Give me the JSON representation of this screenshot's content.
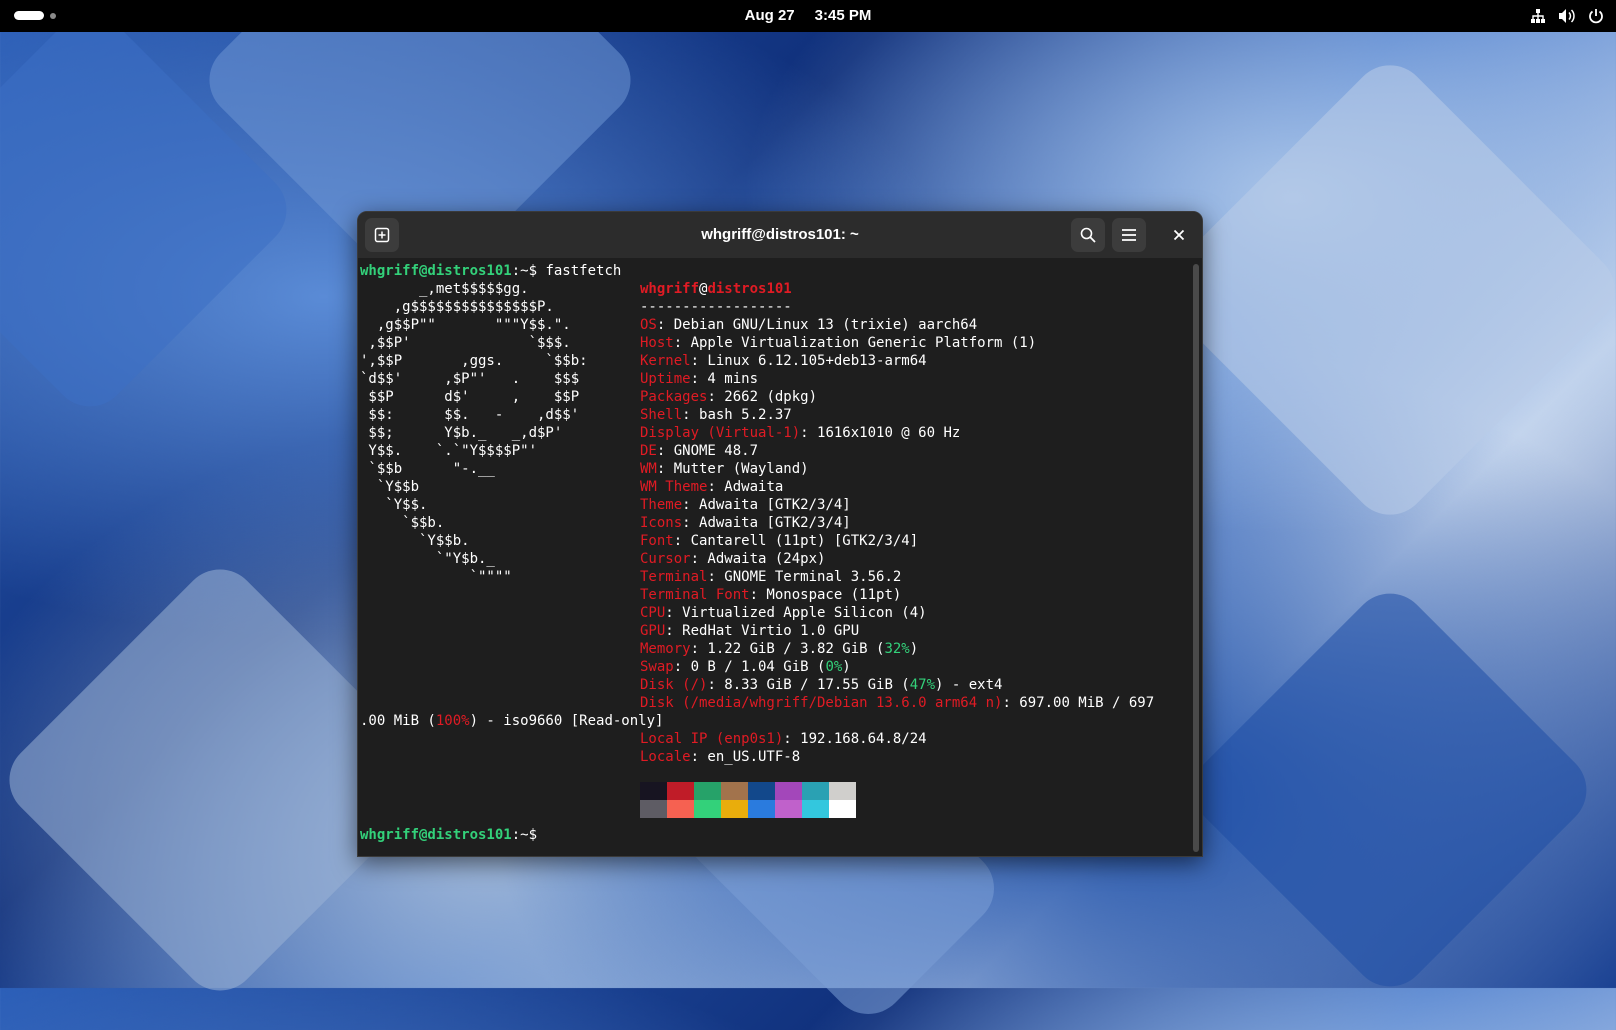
{
  "topbar": {
    "date": "Aug 27",
    "time": "3:45 PM"
  },
  "window": {
    "title": "whgriff@distros101: ~"
  },
  "terminal": {
    "prompt_user_host": "whgriff@distros101",
    "prompt_suffix": ":~$",
    "command": " fastfetch",
    "logo": [
      "       _,met$$$$$gg.",
      "    ,g$$$$$$$$$$$$$$$P.",
      "  ,g$$P\"\"       \"\"\"Y$$.\".",
      " ,$$P'              `$$$.",
      "',$$P       ,ggs.     `$$b:",
      "`d$$'     ,$P\"'   .    $$$",
      " $$P      d$'     ,    $$P",
      " $$:      $$.   -    ,d$$'",
      " $$;      Y$b._   _,d$P'",
      " Y$$.    `.`\"Y$$$$P\"'",
      " `$$b      \"-.__",
      "  `Y$$b",
      "   `Y$$.",
      "     `$$b.",
      "       `Y$$b.",
      "         `\"Y$b._",
      "             `\"\"\"\""
    ],
    "header_user": "whgriff",
    "header_at": "@",
    "header_host": "distros101",
    "separator": "------------------",
    "info": [
      {
        "key": "OS",
        "value": ": Debian GNU/Linux 13 (trixie) aarch64"
      },
      {
        "key": "Host",
        "value": ": Apple Virtualization Generic Platform (1)"
      },
      {
        "key": "Kernel",
        "value": ": Linux 6.12.105+deb13-arm64"
      },
      {
        "key": "Uptime",
        "value": ": 4 mins"
      },
      {
        "key": "Packages",
        "value": ": 2662 (dpkg)"
      },
      {
        "key": "Shell",
        "value": ": bash 5.2.37"
      },
      {
        "key": "Display (Virtual-1)",
        "value": ": 1616x1010 @ 60 Hz"
      },
      {
        "key": "DE",
        "value": ": GNOME 48.7"
      },
      {
        "key": "WM",
        "value": ": Mutter (Wayland)"
      },
      {
        "key": "WM Theme",
        "value": ": Adwaita"
      },
      {
        "key": "Theme",
        "value": ": Adwaita [GTK2/3/4]"
      },
      {
        "key": "Icons",
        "value": ": Adwaita [GTK2/3/4]"
      },
      {
        "key": "Font",
        "value": ": Cantarell (11pt) [GTK2/3/4]"
      },
      {
        "key": "Cursor",
        "value": ": Adwaita (24px)"
      },
      {
        "key": "Terminal",
        "value": ": GNOME Terminal 3.56.2"
      },
      {
        "key": "Terminal Font",
        "value": ": Monospace (11pt)"
      },
      {
        "key": "CPU",
        "value": ": Virtualized Apple Silicon (4)"
      },
      {
        "key": "GPU",
        "value": ": RedHat Virtio 1.0 GPU"
      }
    ],
    "memory": {
      "key": "Memory",
      "pre": ": 1.22 GiB / 3.82 GiB (",
      "pct": "32%",
      "post": ")"
    },
    "swap": {
      "key": "Swap",
      "pre": ": 0 B / 1.04 GiB (",
      "pct": "0%",
      "post": ")"
    },
    "disk_root": {
      "key": "Disk (/)",
      "pre": ": 8.33 GiB / 17.55 GiB (",
      "pct": "47%",
      "post": ") - ext4"
    },
    "disk_media": {
      "key": "Disk (/media/whgriff/Debian 13.6.0 arm64 n)",
      "pre": ": 697.00 MiB / 697"
    },
    "disk_media_wrap": {
      "pre": ".00 MiB (",
      "pct": "100%",
      "post": ") - iso9660 [Read-only]"
    },
    "local_ip": {
      "key": "Local IP (enp0s1)",
      "value": ": 192.168.64.8/24"
    },
    "locale": {
      "key": "Locale",
      "value": ": en_US.UTF-8"
    },
    "palette_top": [
      "#171421",
      "#c01c28",
      "#26a269",
      "#a2734c",
      "#12488b",
      "#a347ba",
      "#2aa1b3",
      "#d0cfcc"
    ],
    "palette_bottom": [
      "#5e5c64",
      "#f66151",
      "#33d17a",
      "#e9ad0c",
      "#2a7bde",
      "#c061cb",
      "#33c7de",
      "#ffffff"
    ]
  }
}
